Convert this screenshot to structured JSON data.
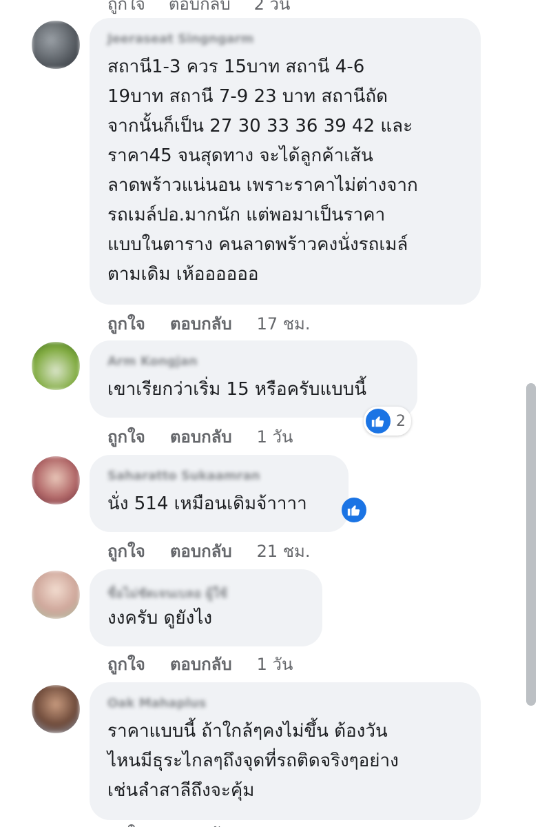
{
  "labels": {
    "like": "ถูกใจ",
    "reply": "ตอบกลับ"
  },
  "top_partial": {
    "like": "ถูกใจ",
    "reply": "ตอบกลับ",
    "time": "2 วัน"
  },
  "comments": [
    {
      "author": "Jeeraseat Singngarm",
      "lines": [
        "สถานี1-3 ควร 15บาท สถานี 4-6",
        "19บาท สถานี 7-9 23 บาท สถานีถัด",
        "จากนั้นก็เป็น 27 30 33 36 39 42 และ",
        "ราคา45 จนสุดทาง จะได้ลูกค้าเส้น",
        "ลาดพร้าวแน่นอน เพราะราคาไม่ต่างจาก",
        "รถเมล์ปอ.มากนัก แต่พอมาเป็นราคา",
        "แบบในตาราง คนลาดพร้าวคงนั่งรถเมล์",
        "ตามเดิม เห้ออออออ"
      ],
      "time": "17 ชม."
    },
    {
      "author": "Arm Kongjan",
      "lines": [
        "เขาเรียกว่าเริ่ม 15 หรือครับแบบนี้"
      ],
      "time": "1 วัน",
      "reaction_count": "2"
    },
    {
      "author": "Saharatto Sukaamran",
      "lines": [
        "นั่ง 514 เหมือนเดิมจ้าาาา"
      ],
      "time": "21 ชม."
    },
    {
      "author": "ชื่อไม่ชัดเจนเบลอ ผู้ใช้",
      "lines": [
        "งงครับ ดูยังไง"
      ],
      "time": "1 วัน"
    },
    {
      "author": "Oak Mahaplus",
      "lines": [
        "ราคาแบบนี้ ถ้าใกล้ๆคงไม่ขึ้น ต้องวัน",
        "ไหนมีธุระไกลๆถึงจุดที่รถติดจริงๆอย่าง",
        "เช่นลำสาลีถึงจะคุ้ม"
      ]
    }
  ],
  "colors": {
    "bubble": "#f0f2f5",
    "like_blue": "#1b74e4",
    "meta_text": "#65676b",
    "scrollbar": "#bcc0c4"
  },
  "icons": {
    "like": "thumbs-up-icon"
  }
}
